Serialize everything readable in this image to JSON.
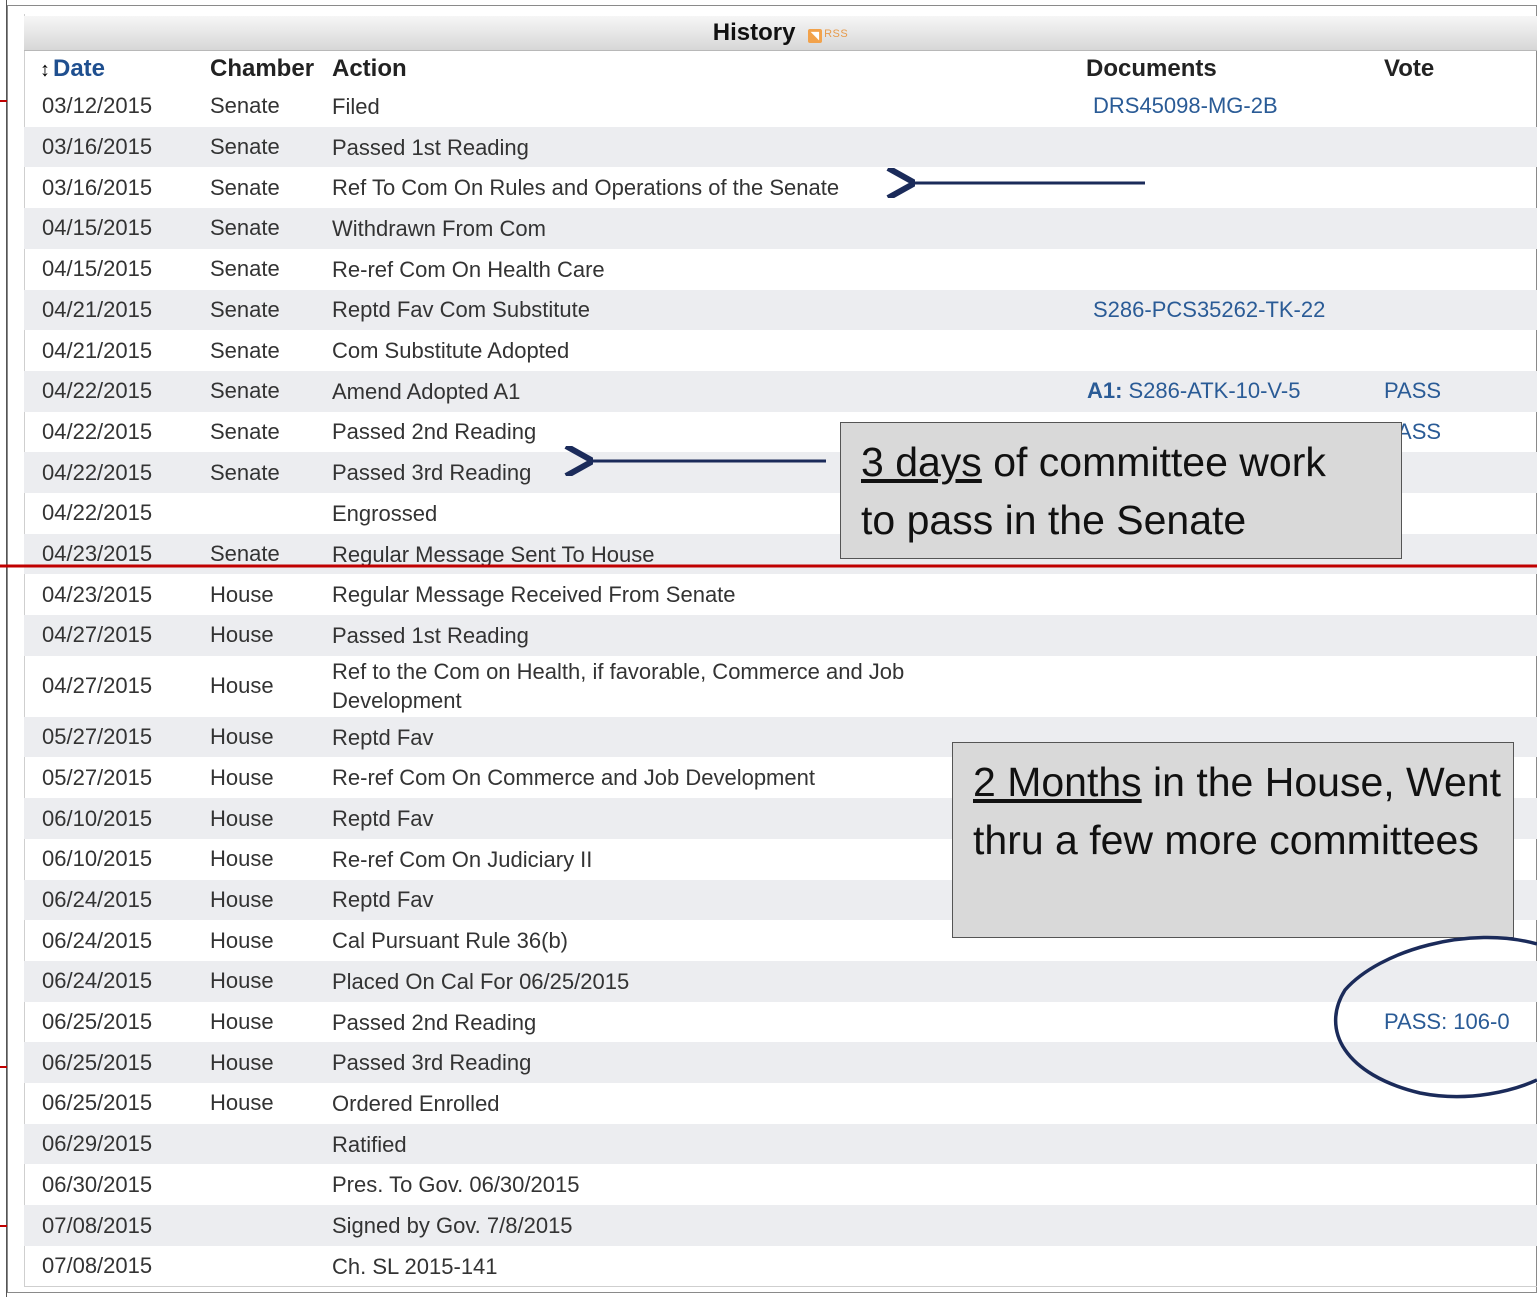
{
  "history": {
    "title": "History",
    "rss_label": "RSS",
    "columns": {
      "date": "Date",
      "chamber": "Chamber",
      "action": "Action",
      "documents": "Documents",
      "vote": "Vote"
    },
    "rows": [
      {
        "date": "03/12/2015",
        "chamber": "Senate",
        "action": "Filed",
        "doc_prefix": "",
        "document": "DRS45098-MG-2B",
        "vote": ""
      },
      {
        "date": "03/16/2015",
        "chamber": "Senate",
        "action": "Passed 1st Reading",
        "doc_prefix": "",
        "document": "",
        "vote": ""
      },
      {
        "date": "03/16/2015",
        "chamber": "Senate",
        "action": "Ref To Com On Rules and Operations of the Senate",
        "doc_prefix": "",
        "document": "",
        "vote": ""
      },
      {
        "date": "04/15/2015",
        "chamber": "Senate",
        "action": "Withdrawn From Com",
        "doc_prefix": "",
        "document": "",
        "vote": ""
      },
      {
        "date": "04/15/2015",
        "chamber": "Senate",
        "action": "Re-ref Com On Health Care",
        "doc_prefix": "",
        "document": "",
        "vote": ""
      },
      {
        "date": "04/21/2015",
        "chamber": "Senate",
        "action": "Reptd Fav Com Substitute",
        "doc_prefix": "",
        "document": "S286-PCS35262-TK-22",
        "vote": ""
      },
      {
        "date": "04/21/2015",
        "chamber": "Senate",
        "action": "Com Substitute Adopted",
        "doc_prefix": "",
        "document": "",
        "vote": ""
      },
      {
        "date": "04/22/2015",
        "chamber": "Senate",
        "action": "Amend Adopted A1",
        "doc_prefix": "A1:",
        "document": "S286-ATK-10-V-5",
        "vote": "PASS"
      },
      {
        "date": "04/22/2015",
        "chamber": "Senate",
        "action": "Passed 2nd Reading",
        "doc_prefix": "",
        "document": "",
        "vote": "PASS"
      },
      {
        "date": "04/22/2015",
        "chamber": "Senate",
        "action": "Passed 3rd Reading",
        "doc_prefix": "",
        "document": "",
        "vote": ""
      },
      {
        "date": "04/22/2015",
        "chamber": "",
        "action": "Engrossed",
        "doc_prefix": "",
        "document": "",
        "vote": ""
      },
      {
        "date": "04/23/2015",
        "chamber": "Senate",
        "action": "Regular Message Sent To House",
        "doc_prefix": "",
        "document": "",
        "vote": ""
      },
      {
        "date": "04/23/2015",
        "chamber": "House",
        "action": "Regular Message Received From Senate",
        "doc_prefix": "",
        "document": "",
        "vote": ""
      },
      {
        "date": "04/27/2015",
        "chamber": "House",
        "action": "Passed 1st Reading",
        "doc_prefix": "",
        "document": "",
        "vote": ""
      },
      {
        "date": "04/27/2015",
        "chamber": "House",
        "action": "Ref to the Com on Health, if favorable, Commerce and Job Development",
        "doc_prefix": "",
        "document": "",
        "vote": ""
      },
      {
        "date": "05/27/2015",
        "chamber": "House",
        "action": "Reptd Fav",
        "doc_prefix": "",
        "document": "",
        "vote": ""
      },
      {
        "date": "05/27/2015",
        "chamber": "House",
        "action": "Re-ref Com On Commerce and Job Development",
        "doc_prefix": "",
        "document": "",
        "vote": ""
      },
      {
        "date": "06/10/2015",
        "chamber": "House",
        "action": "Reptd Fav",
        "doc_prefix": "",
        "document": "",
        "vote": ""
      },
      {
        "date": "06/10/2015",
        "chamber": "House",
        "action": "Re-ref Com On Judiciary II",
        "doc_prefix": "",
        "document": "",
        "vote": ""
      },
      {
        "date": "06/24/2015",
        "chamber": "House",
        "action": "Reptd Fav",
        "doc_prefix": "",
        "document": "",
        "vote": ""
      },
      {
        "date": "06/24/2015",
        "chamber": "House",
        "action": "Cal Pursuant Rule 36(b)",
        "doc_prefix": "",
        "document": "",
        "vote": ""
      },
      {
        "date": "06/24/2015",
        "chamber": "House",
        "action": "Placed On Cal For 06/25/2015",
        "doc_prefix": "",
        "document": "",
        "vote": ""
      },
      {
        "date": "06/25/2015",
        "chamber": "House",
        "action": "Passed 2nd Reading",
        "doc_prefix": "",
        "document": "",
        "vote": "PASS: 106-0"
      },
      {
        "date": "06/25/2015",
        "chamber": "House",
        "action": "Passed 3rd Reading",
        "doc_prefix": "",
        "document": "",
        "vote": ""
      },
      {
        "date": "06/25/2015",
        "chamber": "House",
        "action": "Ordered Enrolled",
        "doc_prefix": "",
        "document": "",
        "vote": ""
      },
      {
        "date": "06/29/2015",
        "chamber": "",
        "action": "Ratified",
        "doc_prefix": "",
        "document": "",
        "vote": ""
      },
      {
        "date": "06/30/2015",
        "chamber": "",
        "action": "Pres. To Gov. 06/30/2015",
        "doc_prefix": "",
        "document": "",
        "vote": ""
      },
      {
        "date": "07/08/2015",
        "chamber": "",
        "action": "Signed by Gov. 7/8/2015",
        "doc_prefix": "",
        "document": "",
        "vote": ""
      },
      {
        "date": "07/08/2015",
        "chamber": "",
        "action": "Ch. SL 2015-141",
        "doc_prefix": "",
        "document": "",
        "vote": ""
      }
    ]
  },
  "annotations": {
    "senate_callout": {
      "underlined": "3 days",
      "rest": " of committee work to pass in the Senate"
    },
    "house_callout": {
      "underlined": "2 Months",
      "rest": " in the House, Went thru a few more committees"
    }
  },
  "colors": {
    "link": "#2a5b96",
    "row_alt": "#ecedf0",
    "arrow": "#1b2b5a",
    "divider": "#c00000",
    "circle": "#1b2b5a",
    "callout_fill": "#d9d9d9"
  }
}
